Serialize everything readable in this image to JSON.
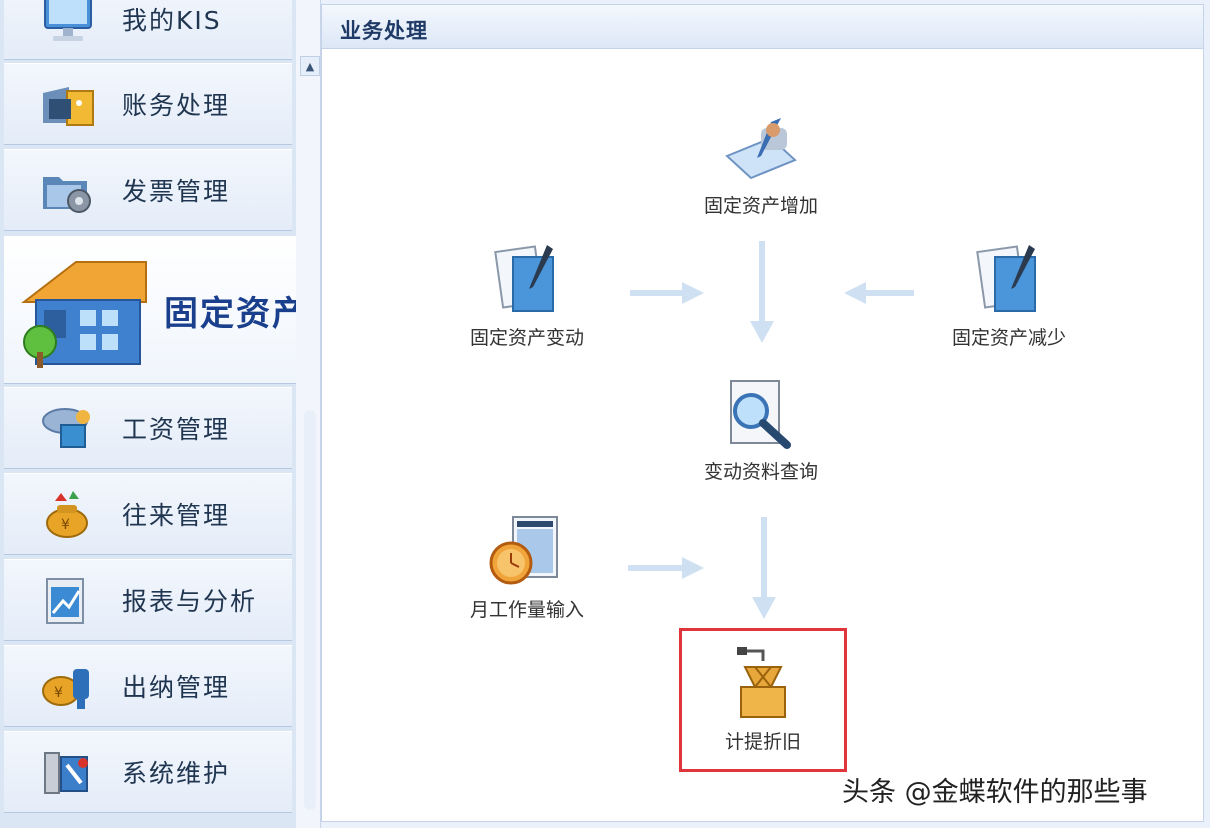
{
  "sidebar": {
    "items": [
      {
        "label": "我的KIS",
        "icon": "computer-icon"
      },
      {
        "label": "账务处理",
        "icon": "ledger-icon"
      },
      {
        "label": "发票管理",
        "icon": "invoice-folder-icon"
      },
      {
        "label": "固定资产",
        "icon": "house-icon",
        "active": true
      },
      {
        "label": "工资管理",
        "icon": "wage-icon"
      },
      {
        "label": "往来管理",
        "icon": "money-bag-icon"
      },
      {
        "label": "报表与分析",
        "icon": "report-icon"
      },
      {
        "label": "出纳管理",
        "icon": "cashier-icon"
      },
      {
        "label": "系统维护",
        "icon": "system-icon"
      }
    ]
  },
  "panel": {
    "title": "业务处理",
    "functions": {
      "asset_add": "固定资产增加",
      "asset_change": "固定资产变动",
      "asset_reduce": "固定资产减少",
      "change_query": "变动资料查询",
      "monthly_workload": "月工作量输入",
      "depreciation": "计提折旧"
    },
    "highlighted": "计提折旧"
  },
  "watermark": "头条 @金蝶软件的那些事",
  "colors": {
    "highlight_border": "#e0353a",
    "arrow": "#cfe0f3",
    "active_label": "#1a3f8c"
  }
}
